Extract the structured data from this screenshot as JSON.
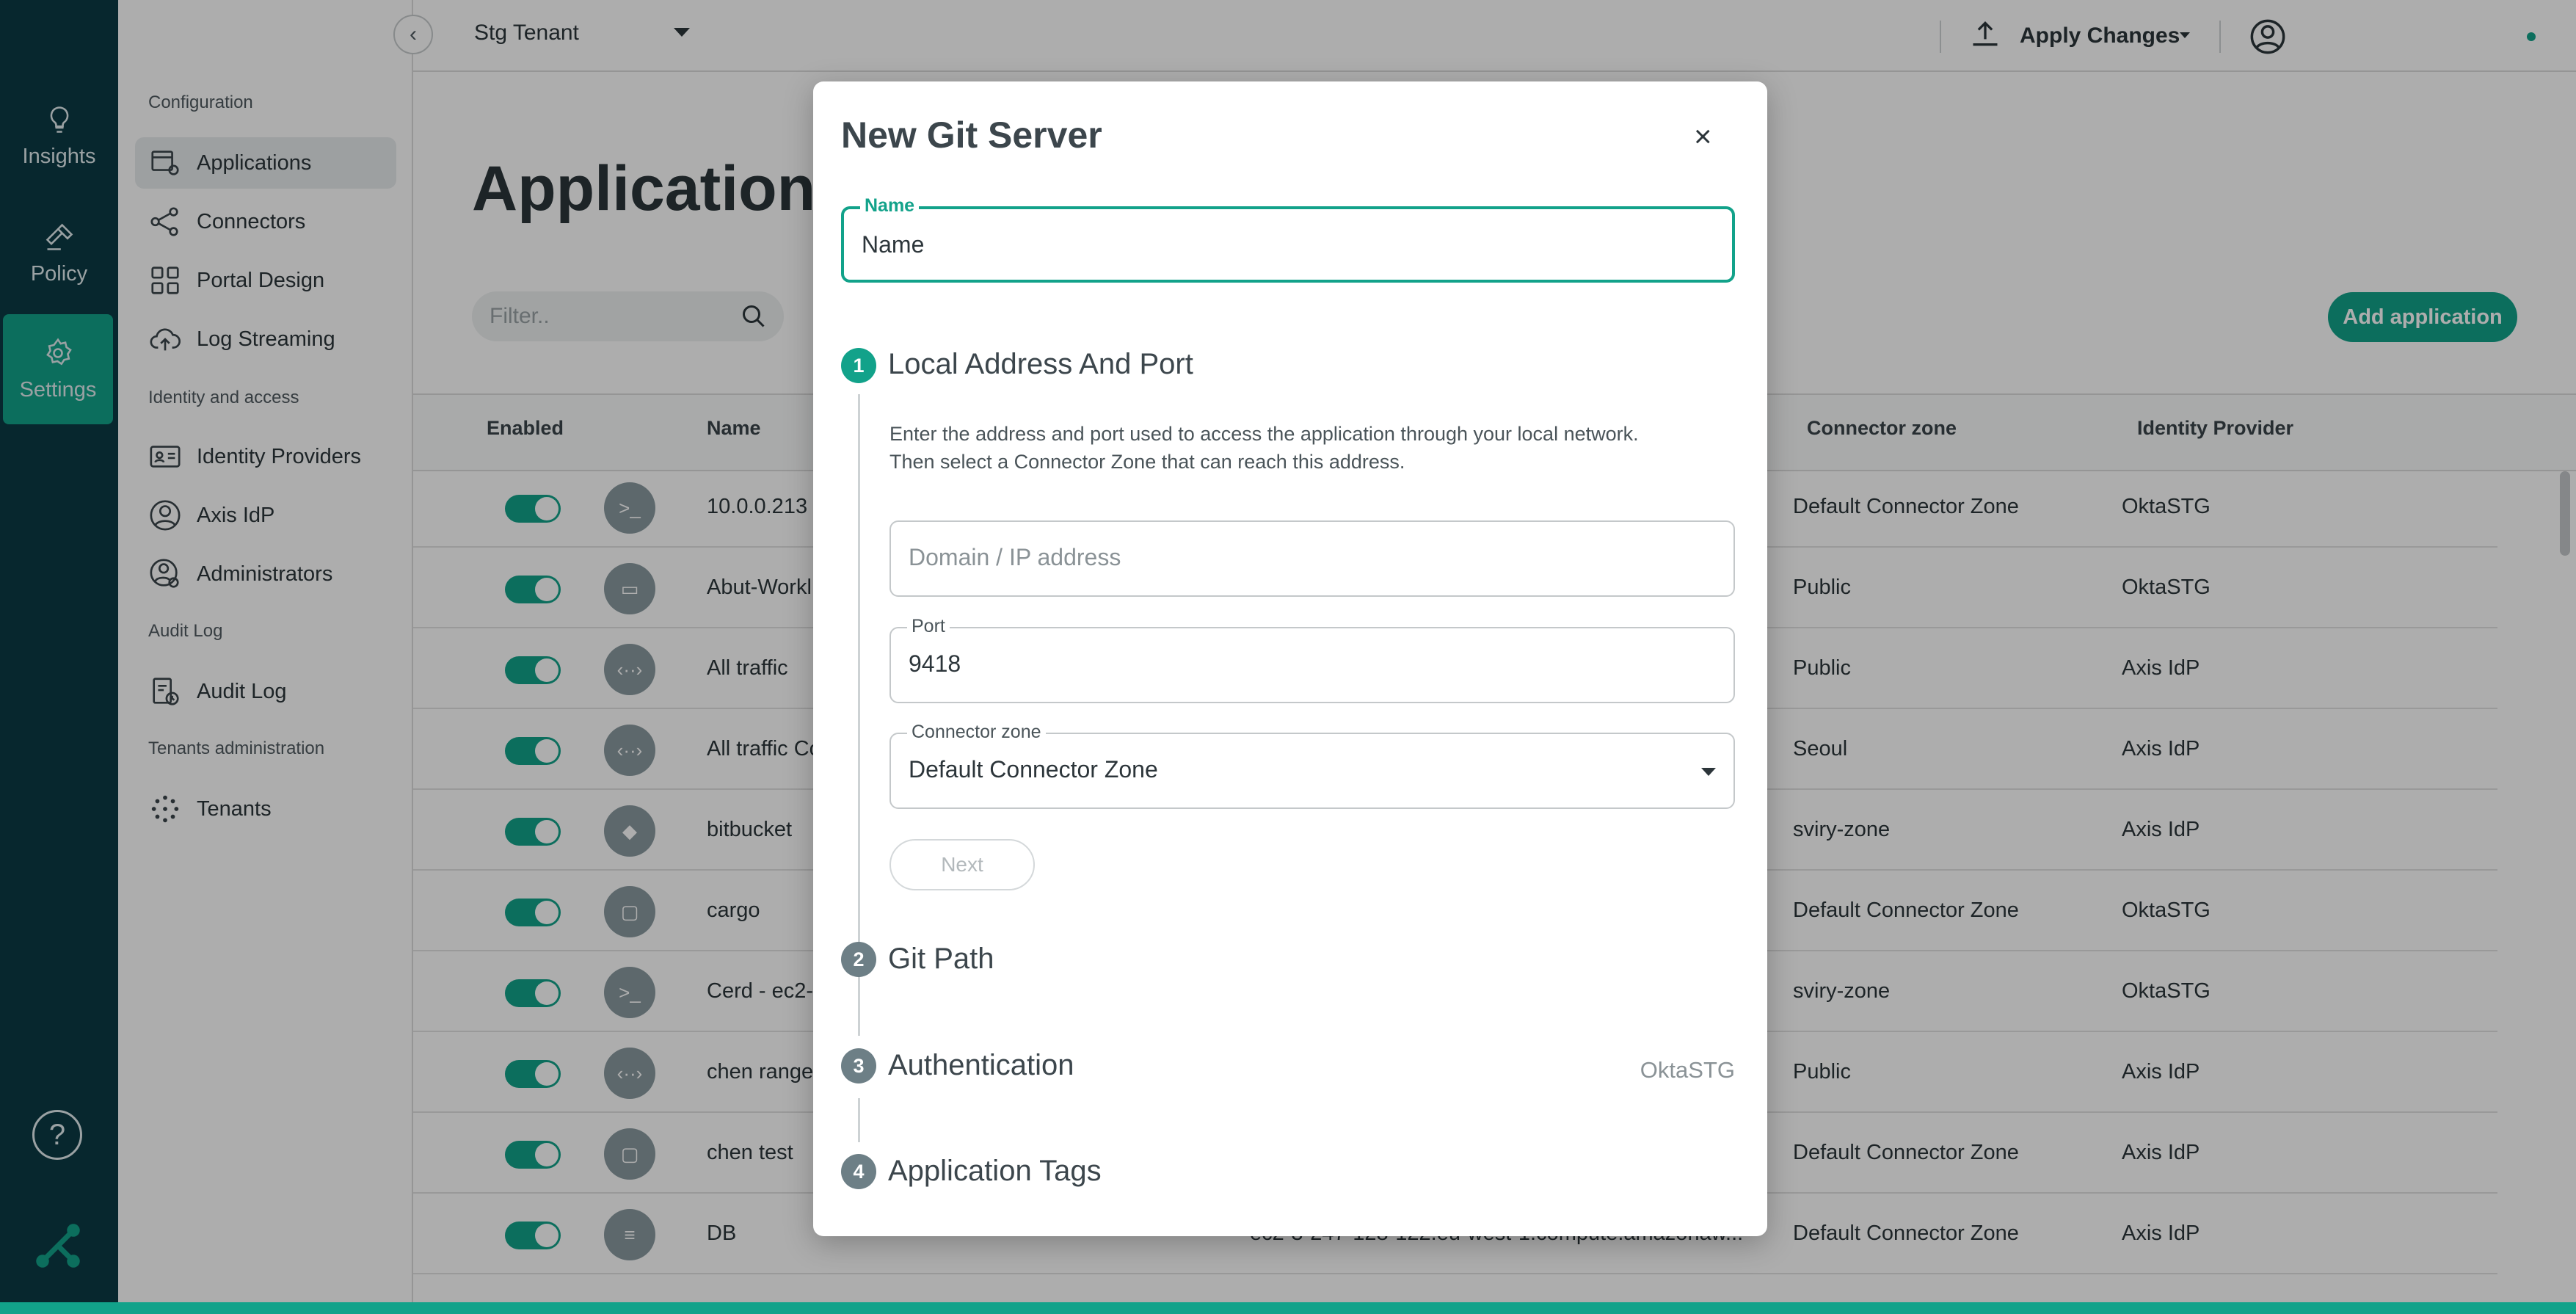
{
  "rail": {
    "insights": "Insights",
    "policy": "Policy",
    "settings": "Settings",
    "help_icon": "question-icon",
    "logo_icon": "brand-logo-icon"
  },
  "sidebar": {
    "sections": {
      "configuration": "Configuration",
      "identity": "Identity and access",
      "audit": "Audit Log",
      "tenants": "Tenants administration"
    },
    "items": [
      {
        "label": "Applications",
        "icon": "applications-gear-icon"
      },
      {
        "label": "Connectors",
        "icon": "share-nodes-icon"
      },
      {
        "label": "Portal Design",
        "icon": "grid-icon"
      },
      {
        "label": "Log Streaming",
        "icon": "cloud-upload-icon"
      },
      {
        "label": "Identity Providers",
        "icon": "id-card-icon"
      },
      {
        "label": "Axis IdP",
        "icon": "user-circle-icon"
      },
      {
        "label": "Administrators",
        "icon": "user-gear-icon"
      },
      {
        "label": "Audit Log",
        "icon": "clipboard-clock-icon"
      },
      {
        "label": "Tenants",
        "icon": "dots-circle-icon"
      }
    ]
  },
  "topbar": {
    "tenant": "Stg Tenant",
    "apply_changes": "Apply Changes"
  },
  "main": {
    "title": "Application s",
    "filter_placeholder": "Filter..",
    "add_button": "Add application",
    "columns": {
      "enabled": "Enabled",
      "name": "Name",
      "zone": "Connector zone",
      "idp": "Identity Provider"
    },
    "rows": [
      {
        "icon": ">_",
        "name": "10.0.0.213",
        "zone": "Default Connector Zone",
        "idp": "OktaSTG"
      },
      {
        "icon": "▭",
        "name": "Abut-Workl",
        "zone": "Public",
        "idp": "OktaSTG"
      },
      {
        "icon": "‹··›",
        "name": "All traffic",
        "zone": "Public",
        "idp": "Axis IdP"
      },
      {
        "icon": "‹··›",
        "name": "All traffic Co",
        "zone": "Seoul",
        "idp": "Axis IdP"
      },
      {
        "icon": "◆",
        "name": "bitbucket",
        "zone": "sviry-zone",
        "idp": "Axis IdP"
      },
      {
        "icon": "▢",
        "name": "cargo",
        "zone": "Default Connector Zone",
        "idp": "OktaSTG"
      },
      {
        "icon": ">_",
        "name": "Cerd - ec2-",
        "zone": "sviry-zone",
        "idp": "OktaSTG"
      },
      {
        "icon": "‹··›",
        "name": "chen range",
        "zone": "Public",
        "idp": "Axis IdP"
      },
      {
        "icon": "▢",
        "name": "chen test",
        "zone": "Default Connector Zone",
        "idp": "Axis IdP"
      },
      {
        "icon": "≡",
        "name": "DB",
        "host": "ec2-3-247-128-122.eu-west-1.compute.amazonaw...",
        "zone": "Default Connector Zone",
        "idp": "Axis IdP"
      }
    ]
  },
  "modal": {
    "title": "New Git Server",
    "name_label": "Name",
    "name_value": "Name",
    "step1": {
      "num": "1",
      "title": "Local Address And Port",
      "desc_line1": "Enter the address and port used to access the application through your local network.",
      "desc_line2": "Then select a Connector Zone that can reach this address.",
      "domain_placeholder": "Domain / IP address",
      "port_label": "Port",
      "port_value": "9418",
      "zone_label": "Connector zone",
      "zone_value": "Default Connector Zone",
      "next": "Next"
    },
    "step2": {
      "num": "2",
      "title": "Git Path"
    },
    "step3": {
      "num": "3",
      "title": "Authentication",
      "value": "OktaSTG"
    },
    "step4": {
      "num": "4",
      "title": "Application Tags"
    }
  }
}
